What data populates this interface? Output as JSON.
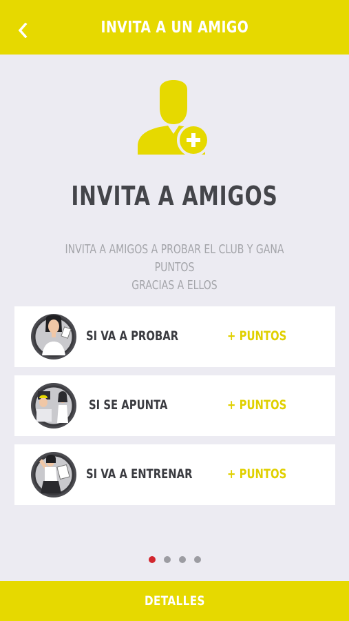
{
  "header": {
    "title": "INVITA A UN AMIGO",
    "back_icon": "chevron-left-icon"
  },
  "hero": {
    "icon": "add-user-icon",
    "title": "INVITA A AMIGOS",
    "subtitle_line1": "INVITA A AMIGOS A PROBAR EL CLUB Y GANA PUNTOS",
    "subtitle_line2": "GRACIAS A ELLOS"
  },
  "rewards": [
    {
      "label": "SI VA A PROBAR",
      "points": "+ PUNTOS",
      "icon": "trial-avatar"
    },
    {
      "label": "SI SE APUNTA",
      "points": "+ PUNTOS",
      "icon": "signup-avatar"
    },
    {
      "label": "SI VA A ENTRENAR",
      "points": "+ PUNTOS",
      "icon": "training-avatar"
    }
  ],
  "pagination": {
    "total": 4,
    "active": 1
  },
  "footer": {
    "label": "DETALLES"
  },
  "colors": {
    "accent": "#e6d900",
    "background": "#ecebf2",
    "text_dark": "#44454a",
    "text_muted": "#a4a5aa",
    "active_dot": "#d2262e"
  }
}
